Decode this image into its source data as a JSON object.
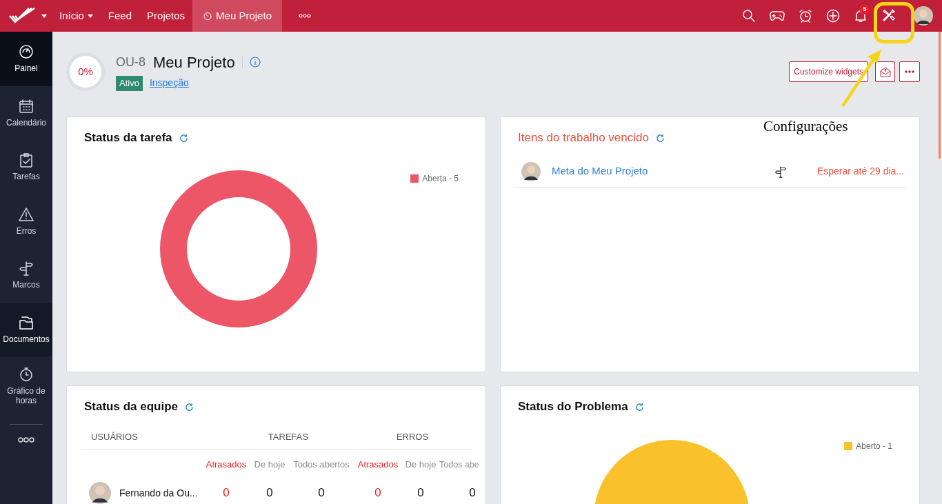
{
  "topbar": {
    "nav": [
      {
        "label": "Início",
        "dropdown": true,
        "selected": false
      },
      {
        "label": "Feed",
        "dropdown": false,
        "selected": false
      },
      {
        "label": "Projetos",
        "dropdown": false,
        "selected": false
      },
      {
        "label": "Meu Projeto",
        "dropdown": false,
        "selected": true
      }
    ],
    "notification_count": "5"
  },
  "sidebar": {
    "items": [
      {
        "label": "Painel",
        "selected": true,
        "hovered": false
      },
      {
        "label": "Calendário",
        "selected": false,
        "hovered": false
      },
      {
        "label": "Tarefas",
        "selected": false,
        "hovered": false
      },
      {
        "label": "Erros",
        "selected": false,
        "hovered": false
      },
      {
        "label": "Marcos",
        "selected": false,
        "hovered": false
      },
      {
        "label": "Documentos",
        "selected": false,
        "hovered": true
      },
      {
        "label": "Gráfico de horas",
        "selected": false,
        "hovered": false
      }
    ]
  },
  "project": {
    "progress": "0%",
    "key": "OU-8",
    "name": "Meu Projeto",
    "status": "Ativo",
    "layout_link": "Inspeção",
    "customize_button": "Customize widgets"
  },
  "task_status": {
    "title": "Status da tarefa",
    "legend": [
      {
        "label": "Aberta - 5",
        "color": "#ec5667"
      }
    ]
  },
  "overdue_items": {
    "title": "Itens do trabalho vencido",
    "items": [
      {
        "title": "Meta do Meu Projeto",
        "due": "Esperar até 29 dia..."
      }
    ]
  },
  "team_status": {
    "title": "Status da equipe",
    "users_header": "USUÁRIOS",
    "groups": [
      "TAREFAS",
      "ERROS"
    ],
    "subcolumns": [
      {
        "label": "Atrasados",
        "kind": "overdue"
      },
      {
        "label": "De hoje",
        "kind": "normal"
      },
      {
        "label": "Todos abertos",
        "kind": "normal"
      },
      {
        "label": "Atrasados",
        "kind": "overdue"
      },
      {
        "label": "De hoje",
        "kind": "normal"
      },
      {
        "label": "Todos abe",
        "kind": "normal"
      }
    ],
    "rows": [
      {
        "name": "Fernando da Ou...",
        "values": [
          {
            "text": "0",
            "kind": "overdue"
          },
          {
            "text": "0",
            "kind": "normal"
          },
          {
            "text": "0",
            "kind": "normal"
          },
          {
            "text": "0",
            "kind": "overdue"
          },
          {
            "text": "0",
            "kind": "normal"
          },
          {
            "text": "0",
            "kind": "normal"
          }
        ]
      }
    ]
  },
  "issue_status": {
    "title": "Status do Problema",
    "legend": [
      {
        "label": "Aberto - 1",
        "color": "#fbc12d"
      }
    ]
  },
  "annotation": {
    "label": "Configurações"
  }
}
